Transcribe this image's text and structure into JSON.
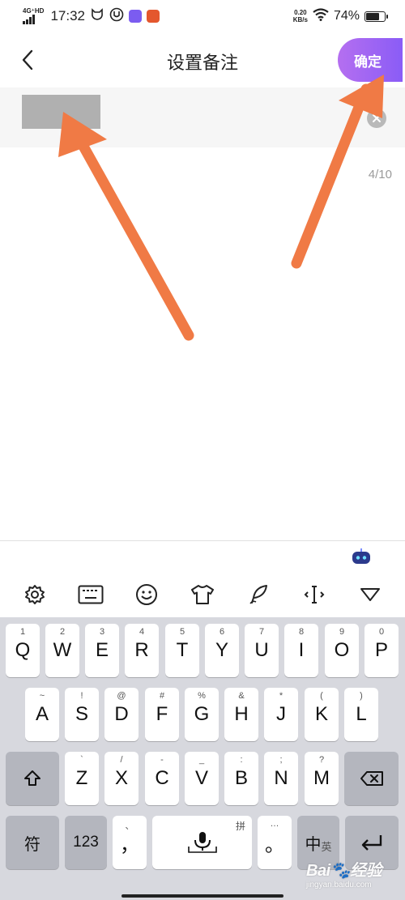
{
  "status_bar": {
    "network": "4G⁺HD",
    "time": "17:32",
    "speed_value": "0.20",
    "speed_unit": "KB/s",
    "battery": "74%",
    "battery_level": 0.74
  },
  "header": {
    "title": "设置备注",
    "confirm_label": "确定"
  },
  "remark_input": {
    "value": "",
    "counter": "4/10"
  },
  "colors": {
    "accent_from": "#b56ff0",
    "accent_to": "#8a5cf6",
    "annotation_arrow": "#f07a45"
  },
  "keyboard": {
    "toolbar_icons": [
      "gear-icon",
      "keyboard-icon",
      "smiley-icon",
      "tshirt-icon",
      "quill-icon",
      "cursor-move-icon",
      "collapse-icon"
    ],
    "row1": [
      {
        "main": "Q",
        "sub": "1"
      },
      {
        "main": "W",
        "sub": "2"
      },
      {
        "main": "E",
        "sub": "3"
      },
      {
        "main": "R",
        "sub": "4"
      },
      {
        "main": "T",
        "sub": "5"
      },
      {
        "main": "Y",
        "sub": "6"
      },
      {
        "main": "U",
        "sub": "7"
      },
      {
        "main": "I",
        "sub": "8"
      },
      {
        "main": "O",
        "sub": "9"
      },
      {
        "main": "P",
        "sub": "0"
      }
    ],
    "row2": [
      {
        "main": "A",
        "sub": "~"
      },
      {
        "main": "S",
        "sub": "!"
      },
      {
        "main": "D",
        "sub": "@"
      },
      {
        "main": "F",
        "sub": "#"
      },
      {
        "main": "G",
        "sub": "%"
      },
      {
        "main": "H",
        "sub": "&"
      },
      {
        "main": "J",
        "sub": "*"
      },
      {
        "main": "K",
        "sub": "("
      },
      {
        "main": "L",
        "sub": ")"
      }
    ],
    "row3": [
      {
        "main": "Z",
        "sub": "`"
      },
      {
        "main": "X",
        "sub": "/"
      },
      {
        "main": "C",
        "sub": "-"
      },
      {
        "main": "V",
        "sub": "_"
      },
      {
        "main": "B",
        "sub": ":"
      },
      {
        "main": "N",
        "sub": ";"
      },
      {
        "main": "M",
        "sub": "?"
      }
    ],
    "row4": {
      "symbol": "符",
      "numbers": "123",
      "comma": "，",
      "comma_sub": "、",
      "pinyin_badge": "拼",
      "period": "。",
      "period_sub": "…",
      "lang_main": "中",
      "lang_sub": "英"
    }
  },
  "watermark": {
    "logo": "Bai🐾经验",
    "url": "jingyan.baidu.com"
  }
}
